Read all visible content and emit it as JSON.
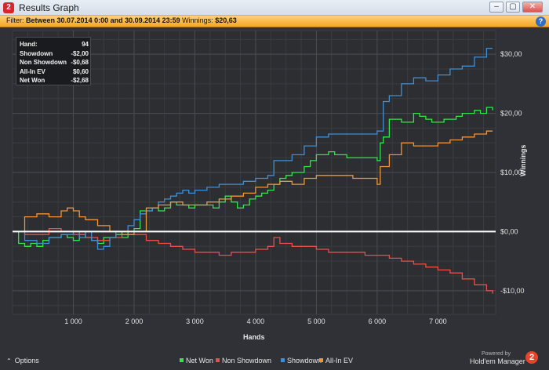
{
  "window": {
    "title": "Results Graph",
    "minimize": "‒",
    "maximize": "▢",
    "close": "✕"
  },
  "filter": {
    "label": "Filter:",
    "text": "Between 30.07.2014 0:00 and 30.09.2014 23:59",
    "winnings_label": "Winnings:",
    "winnings_value": "$20,63"
  },
  "stats": [
    {
      "label": "Hand:",
      "value": "94"
    },
    {
      "label": "Showdown",
      "value": "-$2,00"
    },
    {
      "label": "Non Showdown",
      "value": "-$0,68"
    },
    {
      "label": "All-In EV",
      "value": "$0,60"
    },
    {
      "label": "Net Won",
      "value": "-$2,68"
    }
  ],
  "footer": {
    "options": "Options",
    "powered": "Powered by",
    "brand": "Hold'em Manager"
  },
  "chart_data": {
    "type": "line",
    "xlabel": "Hands",
    "ylabel": "Winnings",
    "xlim": [
      0,
      7950
    ],
    "ylim": [
      -14,
      34
    ],
    "xticks": [
      1000,
      2000,
      3000,
      4000,
      5000,
      6000,
      7000
    ],
    "xtick_labels": [
      "1 000",
      "2 000",
      "3 000",
      "4 000",
      "5 000",
      "6 000",
      "7 000"
    ],
    "yticks": [
      30,
      20,
      10,
      0,
      -10
    ],
    "ytick_labels": [
      "$30,00",
      "$20,00",
      "$10,00",
      "$0,00",
      "-$10,00"
    ],
    "grid": true,
    "legend_position": "bottom",
    "series": [
      {
        "name": "Net Won",
        "color": "#2ee84a",
        "x": [
          0,
          100,
          200,
          300,
          400,
          500,
          600,
          800,
          900,
          1000,
          1100,
          1200,
          1300,
          1400,
          1500,
          1600,
          1700,
          1800,
          1900,
          2000,
          2100,
          2200,
          2300,
          2400,
          2500,
          2600,
          2700,
          2800,
          2900,
          3000,
          3100,
          3200,
          3300,
          3400,
          3500,
          3600,
          3700,
          3800,
          3900,
          4000,
          4100,
          4200,
          4300,
          4400,
          4500,
          4600,
          4700,
          4800,
          4900,
          5000,
          5100,
          5200,
          5300,
          5400,
          5500,
          5600,
          5700,
          5800,
          5900,
          6000,
          6050,
          6100,
          6200,
          6300,
          6400,
          6500,
          6600,
          6700,
          6800,
          6900,
          7000,
          7100,
          7200,
          7300,
          7400,
          7500,
          7600,
          7700,
          7800,
          7900
        ],
        "y": [
          0,
          -2,
          -2.5,
          -2,
          -2.5,
          -1.5,
          -1,
          -0.5,
          -1,
          -1.5,
          -0.5,
          -1,
          -1.5,
          -2,
          -1,
          -1,
          -0.5,
          -1,
          0,
          0.5,
          3.5,
          3.5,
          4,
          3.5,
          4,
          5,
          4.5,
          4.5,
          4,
          4.5,
          4.5,
          4.5,
          4,
          5,
          6,
          5,
          4,
          4.5,
          5.5,
          6,
          6.5,
          7,
          8,
          9,
          9.5,
          10,
          10,
          11,
          12,
          13,
          13,
          13.5,
          13,
          13,
          12.5,
          12.5,
          12.5,
          12.5,
          12.5,
          12,
          15,
          16,
          19,
          19,
          18.5,
          18.5,
          20,
          19.5,
          19,
          18.5,
          18.5,
          19,
          19,
          19.5,
          20,
          20,
          20.5,
          20,
          21,
          20.5
        ]
      },
      {
        "name": "Non Showdown",
        "color": "#ea4f45",
        "x": [
          0,
          200,
          400,
          600,
          800,
          1000,
          1200,
          1400,
          1600,
          1800,
          2000,
          2200,
          2400,
          2600,
          2800,
          3000,
          3200,
          3400,
          3600,
          3800,
          4000,
          4200,
          4300,
          4400,
          4600,
          4800,
          5000,
          5200,
          5400,
          5600,
          5800,
          6000,
          6200,
          6400,
          6600,
          6800,
          7000,
          7200,
          7400,
          7600,
          7800,
          7900
        ],
        "y": [
          0,
          -0.5,
          -0.5,
          0.5,
          0,
          -0.5,
          -1,
          -1.5,
          -1,
          -0.5,
          -0.5,
          -1.5,
          -2,
          -2.5,
          -3,
          -3.5,
          -3.5,
          -4,
          -3.5,
          -3.5,
          -3,
          -2.5,
          -1,
          -2,
          -2.5,
          -2.5,
          -3,
          -3.5,
          -3.5,
          -3.5,
          -4,
          -4,
          -4.5,
          -5,
          -5.5,
          -6,
          -6.5,
          -7,
          -8,
          -9,
          -10,
          -10.5
        ]
      },
      {
        "name": "Showdown",
        "color": "#3f8fd6",
        "x": [
          0,
          200,
          400,
          600,
          800,
          1000,
          1100,
          1200,
          1300,
          1400,
          1500,
          1600,
          1700,
          1800,
          1900,
          2000,
          2100,
          2200,
          2300,
          2400,
          2500,
          2600,
          2700,
          2800,
          2900,
          3000,
          3200,
          3400,
          3600,
          3800,
          4000,
          4200,
          4300,
          4400,
          4600,
          4800,
          5000,
          5200,
          5400,
          5600,
          5800,
          6000,
          6100,
          6200,
          6400,
          6600,
          6800,
          7000,
          7200,
          7400,
          7600,
          7800,
          7900
        ],
        "y": [
          0,
          -1.5,
          -2,
          -1,
          -0.5,
          0,
          -1,
          0,
          -1.5,
          -3,
          -2.5,
          -1,
          0,
          0,
          1,
          2,
          3,
          3.5,
          4,
          5,
          5.5,
          6,
          6.5,
          7,
          6.5,
          7,
          7.5,
          8,
          8,
          8.5,
          9,
          9.5,
          12,
          12,
          13,
          14.5,
          16,
          16.5,
          16.5,
          16.5,
          16.5,
          17,
          22,
          23,
          25,
          26,
          25.5,
          26.5,
          27.5,
          28,
          29.5,
          31,
          31
        ]
      },
      {
        "name": "All-In EV",
        "color": "#f0953a",
        "x": [
          0,
          200,
          400,
          600,
          800,
          900,
          1000,
          1100,
          1200,
          1400,
          1600,
          1800,
          2000,
          2200,
          2400,
          2600,
          2800,
          3000,
          3200,
          3400,
          3600,
          3800,
          4000,
          4200,
          4400,
          4600,
          4800,
          5000,
          5200,
          5400,
          5600,
          5800,
          6000,
          6050,
          6200,
          6400,
          6600,
          6800,
          7000,
          7200,
          7400,
          7600,
          7800,
          7900
        ],
        "y": [
          0,
          2.5,
          3,
          2.5,
          3.5,
          4,
          3.5,
          2.5,
          2,
          1,
          0,
          -0.5,
          0,
          4,
          4.5,
          5,
          4.5,
          4.5,
          5,
          5.5,
          6,
          6.5,
          7.5,
          8,
          8.5,
          8,
          9,
          9.5,
          9.5,
          9.5,
          9,
          9,
          8,
          11,
          13,
          15,
          14.5,
          14.5,
          15,
          15.5,
          16,
          16.5,
          17,
          17
        ]
      }
    ]
  }
}
